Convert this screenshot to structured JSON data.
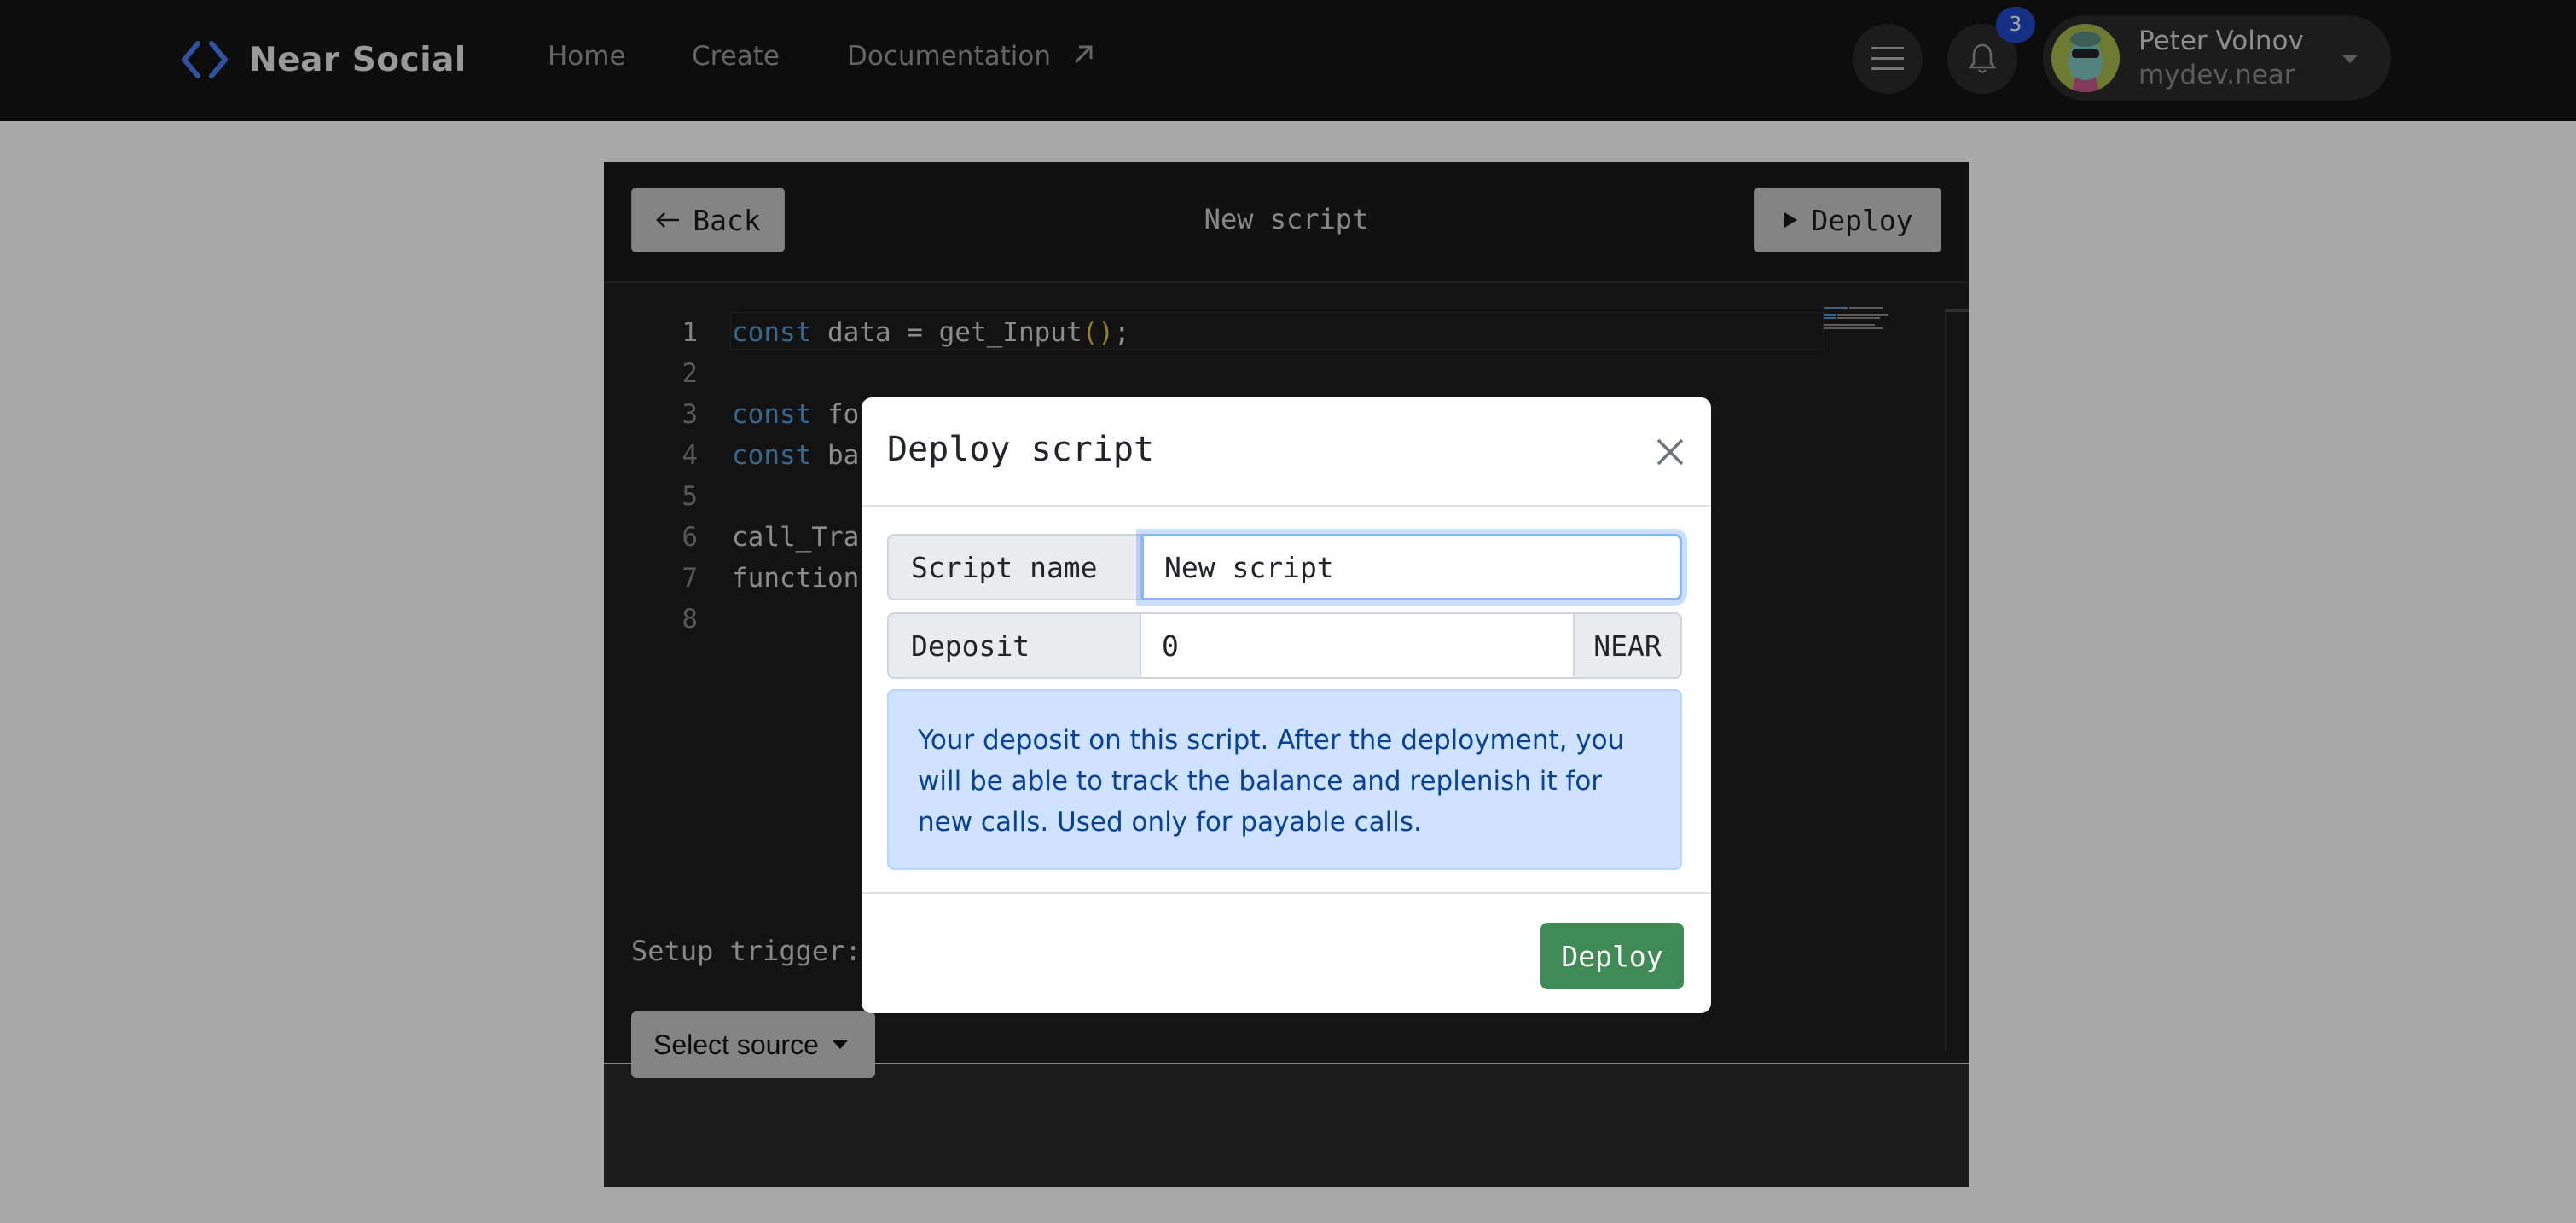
{
  "nav": {
    "brand": "Near Social",
    "links": [
      "Home",
      "Create",
      "Documentation"
    ],
    "notification_count": "3",
    "profile": {
      "name": "Peter Volnov",
      "handle": "mydev.near"
    }
  },
  "editor": {
    "back_label": "Back",
    "title": "New script",
    "deploy_label": "Deploy",
    "lines": [
      {
        "num": "1"
      },
      {
        "num": "2"
      },
      {
        "num": "3"
      },
      {
        "num": "4"
      },
      {
        "num": "5"
      },
      {
        "num": "6"
      },
      {
        "num": "7"
      },
      {
        "num": "8"
      }
    ],
    "code": {
      "l1_kw": "const",
      "l1_rest": " data = get_Input",
      "l1_paren": "()",
      "l1_end": ";",
      "l3_kw": "const",
      "l3_rest": " fo",
      "l4_kw": "const",
      "l4_rest": " ba",
      "l6": "call_Tra",
      "l7": "function"
    },
    "setup_trigger_label": "Setup trigger:",
    "select_source_label": "Select source"
  },
  "modal": {
    "title": "Deploy script",
    "script_name_label": "Script name",
    "script_name_value": "New script",
    "deposit_label": "Deposit",
    "deposit_value": "0",
    "deposit_unit": "NEAR",
    "info_text": "Your deposit on this script. After the deployment, you will be able to track the balance and replenish it for new calls. Used only for payable calls.",
    "deploy_label": "Deploy"
  },
  "colors": {
    "nav_bg": "#141414",
    "accent_blue": "#4a7ff5",
    "deploy_green": "#3f8a55",
    "info_bg": "#cfe2ff",
    "badge": "#2149c9"
  }
}
